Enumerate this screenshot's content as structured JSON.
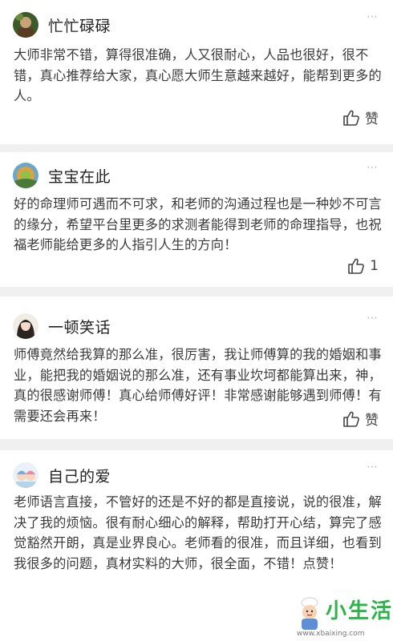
{
  "comments": [
    {
      "username": "忙忙碌碌",
      "text": "大师非常不错，算得很准确，人又很耐心，人品也很好，很不错，真心推荐给大家，真心愿大师生意越来越好，能帮到更多的人。",
      "like_label": "赞"
    },
    {
      "username": "宝宝在此",
      "text": "好的命理师可遇而不可求，和老师的沟通过程也是一种妙不可言的缘分，希望平台里更多的求测者能得到老师的命理指导，也祝福老师能给更多的人指引人生的方向！",
      "like_label": "1"
    },
    {
      "username": "一顿笑话",
      "text": "师傅竟然给我算的那么准，很厉害，我让师傅算的我的婚姻和事业，能把我的婚姻说的那么准，还有事业坎坷都能算出来，神，真的很感谢师傅！真心给师傅好评！非常感谢能够遇到师傅！有需要还会再来！",
      "like_label": "赞"
    },
    {
      "username": "自己的爱",
      "text": "老师语言直接，不管好的还是不好的都是直接说，说的很准，解决了我的烦恼。很有耐心细心的解释，帮助打开心结，算完了感觉豁然开朗，真是业界良心。老师看的很准，而且详细，也看到我很多的问题，真材实料的大师，很全面，不错！点赞！",
      "like_label": "赞"
    }
  ],
  "more_icon": "⋯",
  "watermark": {
    "text": "小生活",
    "url": "www.xbaixing.com"
  },
  "colors": {
    "background": "#f0f0f0",
    "card": "#ffffff",
    "text": "#3a3a3a",
    "watermark_green": "#2eb34a"
  }
}
